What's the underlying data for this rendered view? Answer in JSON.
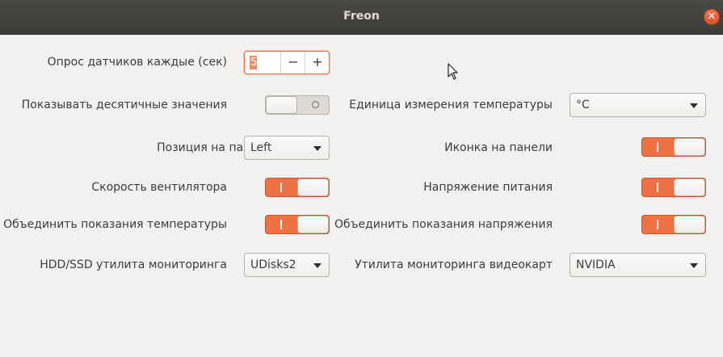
{
  "window": {
    "title": "Freon"
  },
  "colors": {
    "accent": "#ed7143",
    "titlebar": "#3d3c38",
    "background": "#f2f1f0"
  },
  "settings": {
    "poll_interval": {
      "label": "Опрос датчиков каждые (сек)",
      "value": "5",
      "minus": "−",
      "plus": "+"
    },
    "show_decimals": {
      "label": "Показывать десятичные значения",
      "state": "off"
    },
    "temp_unit": {
      "label": "Единица измерения температуры",
      "value": "°C"
    },
    "panel_position": {
      "label": "Позиция на панели",
      "value": "Left"
    },
    "panel_icon": {
      "label": "Иконка на панели",
      "state": "on"
    },
    "fan_speed": {
      "label": "Скорость вентилятора",
      "state": "on"
    },
    "voltage": {
      "label": "Напряжение питания",
      "state": "on"
    },
    "merge_temps": {
      "label": "Объединить показания температуры",
      "state": "on"
    },
    "merge_voltage": {
      "label": "Объединить показания напряжения",
      "state": "on"
    },
    "hdd_utility": {
      "label": "HDD/SSD утилита мониторинга",
      "value": "UDisks2"
    },
    "gpu_utility": {
      "label": "Утилита мониторинга видеокарт",
      "value": "NVIDIA"
    }
  }
}
